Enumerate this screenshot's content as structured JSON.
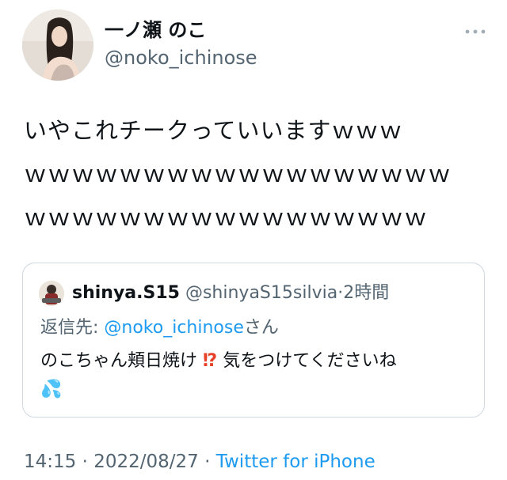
{
  "author": {
    "display_name": "一ノ瀬 のこ",
    "handle": "@noko_ichinose"
  },
  "tweet": {
    "lines": [
      "いやこれチークっていいますｗｗｗ",
      "ｗｗｗｗｗｗｗｗｗｗｗｗｗｗｗｗｗｗ",
      "ｗｗｗｗｗｗｗｗｗｗｗｗｗｗｗｗｗ"
    ]
  },
  "quote": {
    "name": "shinya.S15",
    "handle": "@shinyaS15silvia",
    "dot": "·",
    "time": "2時間",
    "reply_prefix": "返信先: ",
    "reply_mention": "@noko_ichinose",
    "reply_suffix": "さん",
    "text_before": "のこちゃん頬日焼け",
    "text_emoji": "⁉",
    "text_after": "気をつけてくださいね",
    "text_emoji2": "💦"
  },
  "footer": {
    "time": "14:15",
    "dot1": " · ",
    "date": "2022/08/27",
    "dot2": " · ",
    "source": "Twitter for iPhone"
  },
  "icons": {
    "more": "more-horizontal-icon"
  },
  "colors": {
    "link": "#1d9bf0",
    "secondary_text": "#536471",
    "border": "#cfd9de"
  }
}
